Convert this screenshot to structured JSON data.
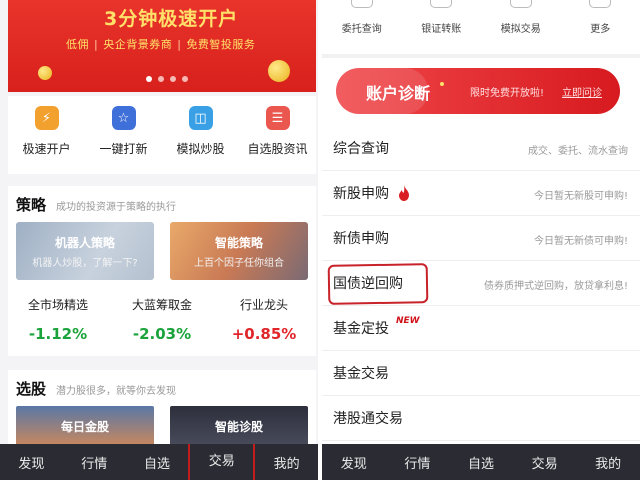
{
  "left": {
    "banner": {
      "title": "3分钟极速开户",
      "subtitle_parts": [
        "低佣",
        "央企背景券商",
        "免费智投服务"
      ],
      "separator": "|"
    },
    "quick_actions": [
      {
        "label": "极速开户",
        "icon": "lightning-icon",
        "color": "#f2a02e",
        "glyph": "⚡"
      },
      {
        "label": "一键打新",
        "icon": "star-icon",
        "color": "#3f6fd8",
        "glyph": "☆"
      },
      {
        "label": "模拟炒股",
        "icon": "gamepad-icon",
        "color": "#3aa0e6",
        "glyph": "◫"
      },
      {
        "label": "自选股资讯",
        "icon": "document-icon",
        "color": "#e9574e",
        "glyph": "☰"
      }
    ],
    "strategy": {
      "title": "策略",
      "subtitle": "成功的投资源于策略的执行",
      "cards": [
        {
          "title": "机器人策略",
          "subtitle": "机器人炒股，了解一下?"
        },
        {
          "title": "智能策略",
          "subtitle": "上百个因子任你组合"
        }
      ],
      "metrics": [
        {
          "label": "全市场精选",
          "value": "-1.12%",
          "color": "#1aa33a"
        },
        {
          "label": "大蓝筹取金",
          "value": "-2.03%",
          "color": "#1aa33a"
        },
        {
          "label": "行业龙头",
          "value": "+0.85%",
          "color": "#e0262b"
        }
      ]
    },
    "pick": {
      "title": "选股",
      "subtitle": "潜力股很多，就等你去发现",
      "cards": [
        {
          "title": "每日金股"
        },
        {
          "title": "智能诊股"
        }
      ]
    },
    "tabs": [
      "发现",
      "行情",
      "自选",
      "交易",
      "我的"
    ]
  },
  "right": {
    "top_icons": [
      "委托查询",
      "银证转账",
      "模拟交易",
      "更多"
    ],
    "diagnosis": {
      "title": "账户诊断",
      "note": "限时免费开放啦!",
      "action": "立即问诊"
    },
    "rows": [
      {
        "label": "综合查询",
        "desc": "成交、委托、流水查询"
      },
      {
        "label": "新股申购",
        "desc": "今日暂无新股可申购!"
      },
      {
        "label": "新债申购",
        "desc": "今日暂无新债可申购!"
      },
      {
        "label": "国债逆回购",
        "desc": "债券质押式逆回购，放贷拿利息!"
      },
      {
        "label": "基金定投",
        "desc": "",
        "badge": "NEW"
      },
      {
        "label": "基金交易",
        "desc": ""
      },
      {
        "label": "港股通交易",
        "desc": ""
      }
    ],
    "tabs": [
      "发现",
      "行情",
      "自选",
      "交易",
      "我的"
    ]
  }
}
